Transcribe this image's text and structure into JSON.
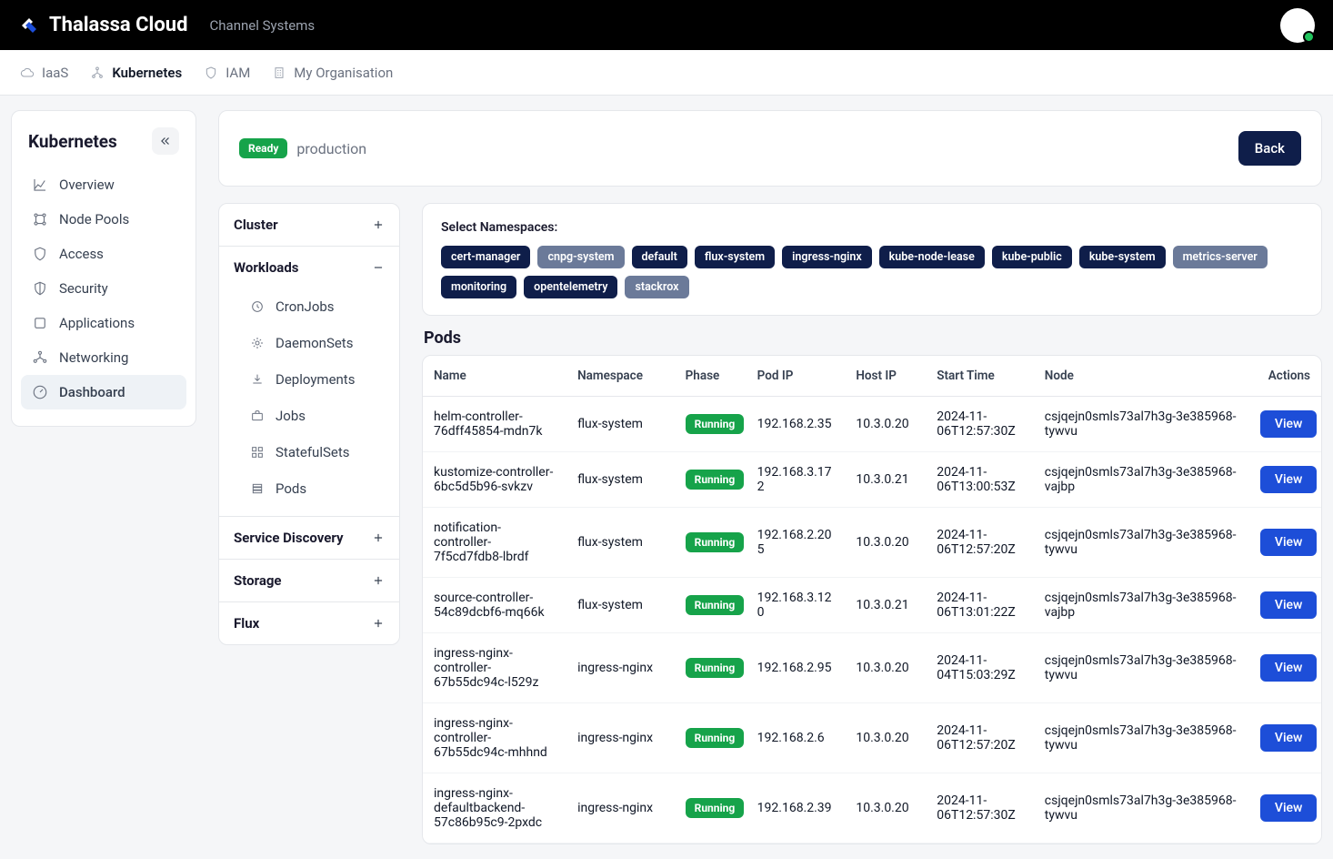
{
  "brand": {
    "name": "Thalassa Cloud",
    "org": "Channel Systems"
  },
  "crumbs": [
    {
      "label": "IaaS",
      "icon": "cloud"
    },
    {
      "label": "Kubernetes",
      "icon": "tree",
      "active": true
    },
    {
      "label": "IAM",
      "icon": "shield"
    },
    {
      "label": "My Organisation",
      "icon": "building"
    }
  ],
  "leftnav": {
    "title": "Kubernetes",
    "items": [
      {
        "label": "Overview",
        "icon": "chart"
      },
      {
        "label": "Node Pools",
        "icon": "nodes"
      },
      {
        "label": "Access",
        "icon": "shield"
      },
      {
        "label": "Security",
        "icon": "halfshield"
      },
      {
        "label": "Applications",
        "icon": "box"
      },
      {
        "label": "Networking",
        "icon": "net"
      },
      {
        "label": "Dashboard",
        "icon": "gauge",
        "active": true
      }
    ]
  },
  "header": {
    "status": "Ready",
    "cluster": "production",
    "back": "Back"
  },
  "tree": {
    "sections": [
      {
        "title": "Cluster",
        "expanded": false
      },
      {
        "title": "Workloads",
        "expanded": true,
        "items": [
          {
            "label": "CronJobs",
            "icon": "clock"
          },
          {
            "label": "DaemonSets",
            "icon": "gear"
          },
          {
            "label": "Deployments",
            "icon": "download"
          },
          {
            "label": "Jobs",
            "icon": "briefcase"
          },
          {
            "label": "StatefulSets",
            "icon": "grid"
          },
          {
            "label": "Pods",
            "icon": "stack"
          }
        ]
      },
      {
        "title": "Service Discovery",
        "expanded": false
      },
      {
        "title": "Storage",
        "expanded": false
      },
      {
        "title": "Flux",
        "expanded": false
      }
    ]
  },
  "namespaces": {
    "label": "Select Namespaces:",
    "chips": [
      {
        "label": "cert-manager"
      },
      {
        "label": "cnpg-system",
        "muted": true
      },
      {
        "label": "default"
      },
      {
        "label": "flux-system"
      },
      {
        "label": "ingress-nginx"
      },
      {
        "label": "kube-node-lease"
      },
      {
        "label": "kube-public"
      },
      {
        "label": "kube-system"
      },
      {
        "label": "metrics-server",
        "muted": true
      },
      {
        "label": "monitoring"
      },
      {
        "label": "opentelemetry"
      },
      {
        "label": "stackrox",
        "muted": true
      }
    ]
  },
  "pods": {
    "title": "Pods",
    "columns": [
      "Name",
      "Namespace",
      "Phase",
      "Pod IP",
      "Host IP",
      "Start Time",
      "Node",
      "Actions"
    ],
    "view": "View",
    "rows": [
      {
        "name": "helm-controller-76dff45854-mdn7k",
        "ns": "flux-system",
        "phase": "Running",
        "podip": "192.168.2.35",
        "hostip": "10.3.0.20",
        "start": "2024-11-06T12:57:30Z",
        "node": "csjqejn0smls73al7h3g-3e385968-tywvu"
      },
      {
        "name": "kustomize-controller-6bc5d5b96-svkzv",
        "ns": "flux-system",
        "phase": "Running",
        "podip": "192.168.3.172",
        "hostip": "10.3.0.21",
        "start": "2024-11-06T13:00:53Z",
        "node": "csjqejn0smls73al7h3g-3e385968-vajbp"
      },
      {
        "name": "notification-controller-7f5cd7fdb8-lbrdf",
        "ns": "flux-system",
        "phase": "Running",
        "podip": "192.168.2.205",
        "hostip": "10.3.0.20",
        "start": "2024-11-06T12:57:20Z",
        "node": "csjqejn0smls73al7h3g-3e385968-tywvu"
      },
      {
        "name": "source-controller-54c89dcbf6-mq66k",
        "ns": "flux-system",
        "phase": "Running",
        "podip": "192.168.3.120",
        "hostip": "10.3.0.21",
        "start": "2024-11-06T13:01:22Z",
        "node": "csjqejn0smls73al7h3g-3e385968-vajbp"
      },
      {
        "name": "ingress-nginx-controller-67b55dc94c-l529z",
        "ns": "ingress-nginx",
        "phase": "Running",
        "podip": "192.168.2.95",
        "hostip": "10.3.0.20",
        "start": "2024-11-04T15:03:29Z",
        "node": "csjqejn0smls73al7h3g-3e385968-tywvu"
      },
      {
        "name": "ingress-nginx-controller-67b55dc94c-mhhnd",
        "ns": "ingress-nginx",
        "phase": "Running",
        "podip": "192.168.2.6",
        "hostip": "10.3.0.20",
        "start": "2024-11-06T12:57:20Z",
        "node": "csjqejn0smls73al7h3g-3e385968-tywvu"
      },
      {
        "name": "ingress-nginx-defaultbackend-57c86b95c9-2pxdc",
        "ns": "ingress-nginx",
        "phase": "Running",
        "podip": "192.168.2.39",
        "hostip": "10.3.0.20",
        "start": "2024-11-06T12:57:30Z",
        "node": "csjqejn0smls73al7h3g-3e385968-tywvu"
      }
    ]
  }
}
